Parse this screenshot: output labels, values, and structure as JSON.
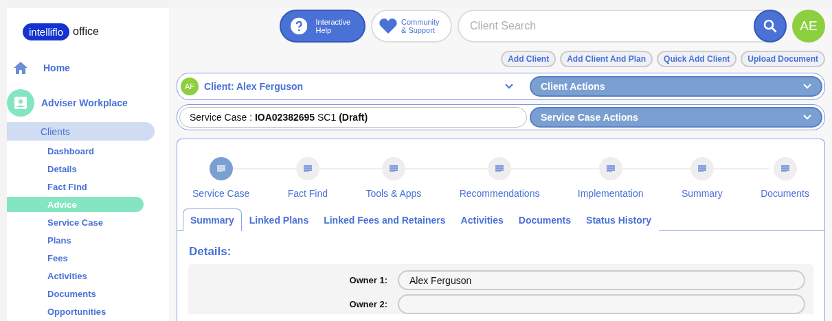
{
  "logo": {
    "brand": "intelliflo",
    "product": "office"
  },
  "sidebar": {
    "home": "Home",
    "section": "Adviser Workplace",
    "clients": {
      "label": "Clients",
      "selected": true
    },
    "items": [
      {
        "label": "Dashboard",
        "selected": false
      },
      {
        "label": "Details",
        "selected": false
      },
      {
        "label": "Fact Find",
        "selected": false
      },
      {
        "label": "Advice",
        "selected": true
      },
      {
        "label": "Service Case",
        "selected": false
      },
      {
        "label": "Plans",
        "selected": false
      },
      {
        "label": "Fees",
        "selected": false
      },
      {
        "label": "Activities",
        "selected": false
      },
      {
        "label": "Documents",
        "selected": false
      },
      {
        "label": "Opportunities",
        "selected": false
      }
    ]
  },
  "topbar": {
    "help": "Interactive Help",
    "community": "Community & Support",
    "search": {
      "placeholder": "Client Search"
    },
    "avatar": "AE"
  },
  "quick_actions": [
    "Add Client",
    "Add Client And Plan",
    "Quick Add Client",
    "Upload Document"
  ],
  "client_bar": {
    "initials": "AF",
    "label": "Client: Alex Ferguson",
    "actions": "Client Actions"
  },
  "service_case_bar": {
    "label": "Service Case : **IOA02382695** SC1 **(Draft)**",
    "actions": "Service Case Actions"
  },
  "steps": [
    {
      "label": "Service Case",
      "selected": true
    },
    {
      "label": "Fact Find",
      "selected": false
    },
    {
      "label": "Tools & Apps",
      "selected": false
    },
    {
      "label": "Recommendations",
      "selected": false
    },
    {
      "label": "Implementation",
      "selected": false
    },
    {
      "label": "Summary",
      "selected": false
    },
    {
      "label": "Documents",
      "selected": false
    }
  ],
  "tabs": [
    {
      "label": "Summary",
      "selected": true
    },
    {
      "label": "Linked Plans",
      "selected": false
    },
    {
      "label": "Linked Fees and Retainers",
      "selected": false
    },
    {
      "label": "Activities",
      "selected": false
    },
    {
      "label": "Documents",
      "selected": false
    },
    {
      "label": "Status History",
      "selected": false
    }
  ],
  "details": {
    "title": "Details:",
    "fields": [
      {
        "label": "Owner 1:",
        "value": "Alex Ferguson"
      },
      {
        "label": "Owner 2:"
      }
    ]
  }
}
